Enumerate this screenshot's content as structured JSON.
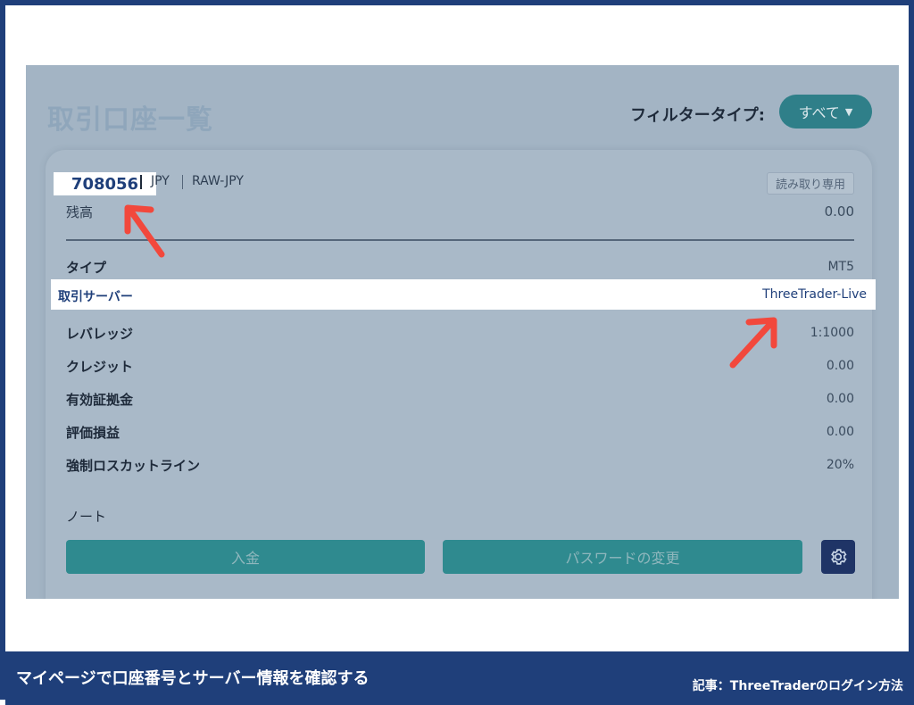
{
  "header": {
    "title": "取引口座一覧",
    "filter_label": "フィルタータイプ:",
    "filter_value": "すべて"
  },
  "account": {
    "number": "708056",
    "currency": "JPY",
    "group": "RAW-JPY",
    "badge": "読み取り専用",
    "balance_label": "残高",
    "balance_value": "0.00"
  },
  "rows": {
    "type": {
      "label": "タイプ",
      "value": "MT5"
    },
    "server": {
      "label": "取引サーバー",
      "value": "ThreeTrader-Live"
    },
    "leverage": {
      "label": "レバレッジ",
      "value": "1:1000"
    },
    "credit": {
      "label": "クレジット",
      "value": "0.00"
    },
    "equity": {
      "label": "有効証拠金",
      "value": "0.00"
    },
    "pnl": {
      "label": "評価損益",
      "value": "0.00"
    },
    "stopout": {
      "label": "強制ロスカットライン",
      "value": "20%"
    }
  },
  "note_label": "ノート",
  "buttons": {
    "deposit": "入金",
    "change_password": "パスワードの変更"
  },
  "icons": {
    "settings": "gear-icon",
    "dropdown": "chevron-down-icon",
    "annotation_arrow": "arrow-icon"
  },
  "colors": {
    "frame": "#1f3f7a",
    "teal": "#2f7f89",
    "arrow": "#f2483c"
  },
  "caption": {
    "main": "マイページで口座番号とサーバー情報を確認する",
    "sub": "記事：ThreeTraderのログイン方法"
  }
}
